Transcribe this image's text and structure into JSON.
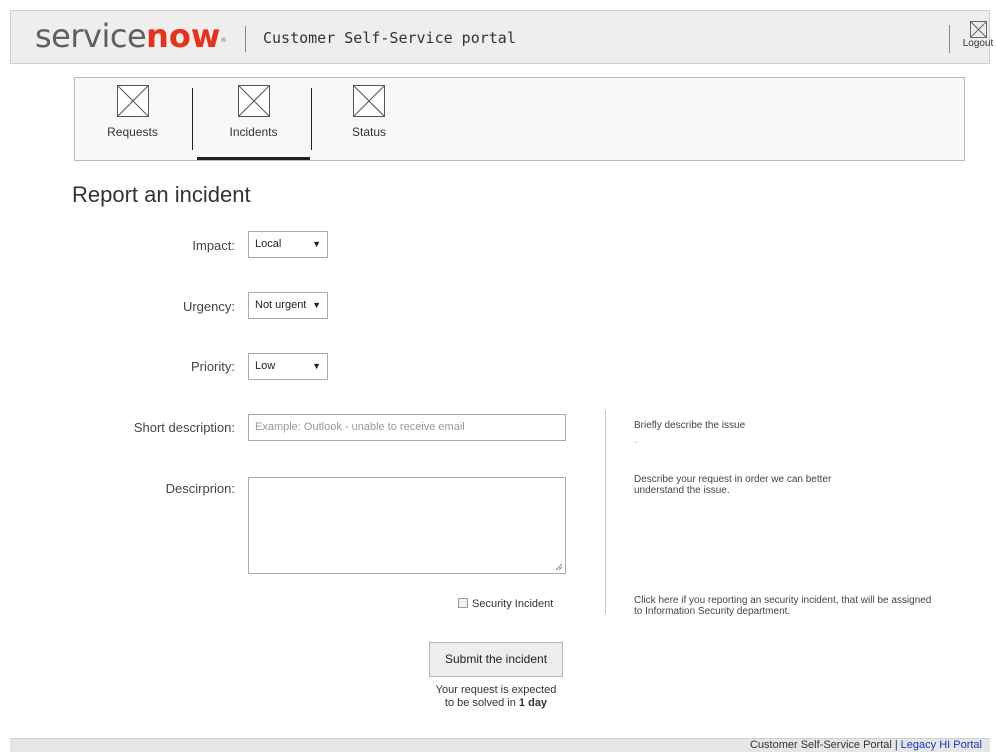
{
  "header": {
    "logo_service": "service",
    "logo_now": "now",
    "logo_mark": "®",
    "portal_title": "Customer Self-Service portal",
    "logout_label": "Logout",
    "logout_icon": "placeholder-image-icon"
  },
  "tabs": [
    {
      "label": "Requests",
      "icon": "placeholder-image-icon",
      "active": false
    },
    {
      "label": "Incidents",
      "icon": "placeholder-image-icon",
      "active": true
    },
    {
      "label": "Status",
      "icon": "placeholder-image-icon",
      "active": false
    }
  ],
  "page": {
    "title": "Report an incident"
  },
  "form": {
    "impact": {
      "label": "Impact:",
      "value": "Local"
    },
    "urgency": {
      "label": "Urgency:",
      "value": "Not urgent"
    },
    "priority": {
      "label": "Priority:",
      "value": "Low"
    },
    "short_description": {
      "label": "Short description:",
      "value": "",
      "placeholder": "Example: Outlook - unable to receive email"
    },
    "description": {
      "label": "Descirprion:",
      "value": ""
    },
    "security_incident": {
      "label": "Security Incident",
      "checked": false
    },
    "submit_label": "Submit the incident",
    "expect_line1": "Your request is expected",
    "expect_line2_prefix": "to be solved in",
    "expect_line2_value": "1 day"
  },
  "help": {
    "short_description": "Briefly describe the issue",
    "short_description_dash": "-",
    "description": "Describe your request in order we can better understand the issue.",
    "security": "Click here if you reporting an security incident, that will be assigned to Information Security department."
  },
  "footer": {
    "portal": "Customer Self-Service Portal",
    "separator": "|",
    "legacy_link": "Legacy HI Portal"
  },
  "colors": {
    "brand_red": "#e8311a",
    "link_blue": "#1a35c4",
    "header_bg": "#eeeeee"
  }
}
